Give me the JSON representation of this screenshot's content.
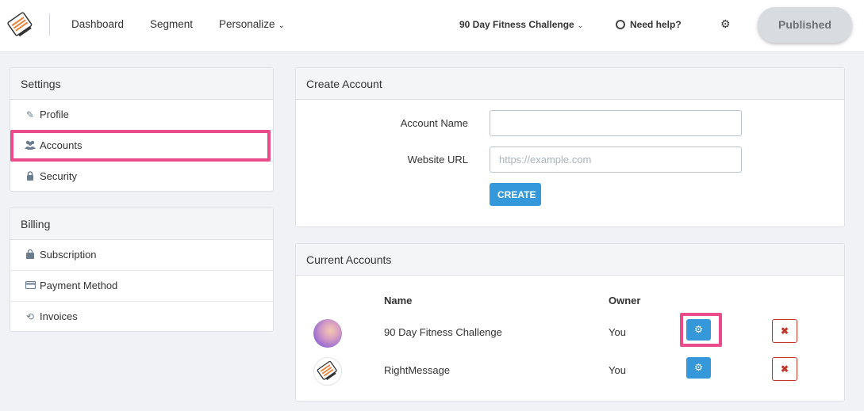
{
  "nav": {
    "items": [
      {
        "label": "Dashboard"
      },
      {
        "label": "Segment"
      },
      {
        "label": "Personalize"
      }
    ],
    "project": "90 Day Fitness Challenge",
    "help": "Need help?",
    "publish_label": "Published"
  },
  "sidebar": {
    "settings": {
      "title": "Settings",
      "items": [
        {
          "label": "Profile",
          "icon": "edit-icon"
        },
        {
          "label": "Accounts",
          "icon": "users-icon"
        },
        {
          "label": "Security",
          "icon": "lock-icon"
        }
      ]
    },
    "billing": {
      "title": "Billing",
      "items": [
        {
          "label": "Subscription",
          "icon": "shopping-bag-icon"
        },
        {
          "label": "Payment Method",
          "icon": "credit-card-icon"
        },
        {
          "label": "Invoices",
          "icon": "history-icon"
        }
      ]
    }
  },
  "create": {
    "title": "Create Account",
    "name_label": "Account Name",
    "name_value": "",
    "url_label": "Website URL",
    "url_placeholder": "https://example.com",
    "button": "CREATE"
  },
  "accounts": {
    "title": "Current Accounts",
    "columns": {
      "name": "Name",
      "owner": "Owner"
    },
    "rows": [
      {
        "name": "90 Day Fitness Challenge",
        "owner": "You"
      },
      {
        "name": "RightMessage",
        "owner": "You"
      }
    ]
  },
  "colors": {
    "accent": "#3498db",
    "highlight": "#ec4b8b",
    "danger": "#c0392b"
  }
}
